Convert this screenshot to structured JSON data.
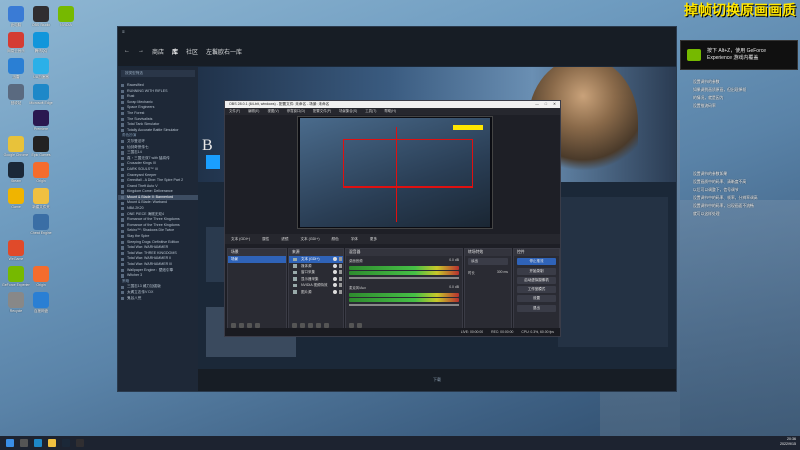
{
  "desktop": {
    "icons": [
      {
        "label": "此电脑",
        "color": "#3a7bd5"
      },
      {
        "label": "OBS Studio",
        "color": "#302e31"
      },
      {
        "label": "NVIDIA",
        "color": "#76b900"
      },
      {
        "label": "网易云音乐",
        "color": "#d43c33"
      },
      {
        "label": "腾讯QQ",
        "color": "#1296db"
      },
      {
        "label": "迅雷",
        "color": "#2a7fd4"
      },
      {
        "label": "UU加速器",
        "color": "#2bb0e8"
      },
      {
        "label": "回收站",
        "color": "#5a6a80"
      },
      {
        "label": "Microsoft Edge",
        "color": "#1e88c8"
      },
      {
        "label": "Premiere",
        "color": "#2a1850"
      },
      {
        "label": "Google Chrome",
        "color": "#e8c23a"
      },
      {
        "label": "Epic Games",
        "color": "#222"
      },
      {
        "label": "Steam",
        "color": "#1b2838"
      },
      {
        "label": "Origin",
        "color": "#f56c2d"
      },
      {
        "label": "Game",
        "color": "#f0b400"
      },
      {
        "label": "新建文件夹",
        "color": "#f0c040"
      },
      {
        "label": "Cheat Engine",
        "color": "#3a6ea5"
      },
      {
        "label": "WeGame",
        "color": "#e04a2a"
      },
      {
        "label": "GeForce Experience",
        "color": "#76b900"
      },
      {
        "label": "Origin",
        "color": "#f56c2d"
      },
      {
        "label": "Recycle",
        "color": "#888"
      },
      {
        "label": "百度网盘",
        "color": "#2a7fd4"
      }
    ]
  },
  "steam": {
    "nav": {
      "back": "←",
      "forward": "→",
      "store": "商店",
      "library": "库",
      "community": "社区",
      "user": "左鬟欧右一库"
    },
    "sidebar": {
      "filter": "按类型筛选",
      "items": [
        {
          "label": "Raceslfied",
          "kind": "item"
        },
        {
          "label": "RUNNING WITH RIFLES",
          "kind": "item"
        },
        {
          "label": "Rust",
          "kind": "item"
        },
        {
          "label": "Scrap Mechanic",
          "kind": "item"
        },
        {
          "label": "Space Engineers",
          "kind": "item"
        },
        {
          "label": "The Forest",
          "kind": "item"
        },
        {
          "label": "The Survivalists",
          "kind": "item"
        },
        {
          "label": "Total Tank Simulator",
          "kind": "item"
        },
        {
          "label": "Totally Accurate Battle Simulator",
          "kind": "item"
        },
        {
          "label": "角色扮演",
          "kind": "group"
        },
        {
          "label": "艾尔登法环",
          "kind": "item"
        },
        {
          "label": "仙剑奇侠传七",
          "kind": "item"
        },
        {
          "label": "三国志14",
          "kind": "item"
        },
        {
          "label": "真・三国无双7 with 猛将传",
          "kind": "item"
        },
        {
          "label": "Crusader Kings III",
          "kind": "item"
        },
        {
          "label": "DARK SOULS™ III",
          "kind": "item"
        },
        {
          "label": "Graveyard Keeper",
          "kind": "item"
        },
        {
          "label": "Greedfall - A Dive: The Spire Part 2",
          "kind": "item"
        },
        {
          "label": "Grand Theft Auto V",
          "kind": "item"
        },
        {
          "label": "Kingdom Come: Deliverance",
          "kind": "item"
        },
        {
          "label": "Mount & Blade II: Bannerlord",
          "kind": "selected"
        },
        {
          "label": "Mount & Blade: Warband",
          "kind": "item"
        },
        {
          "label": "NBA 2K20",
          "kind": "item"
        },
        {
          "label": "ONE PIECE 海贼无双4",
          "kind": "item"
        },
        {
          "label": "Romance of the Three Kingdoms",
          "kind": "item"
        },
        {
          "label": "Romance of the Three Kingdoms",
          "kind": "item"
        },
        {
          "label": "Sekiro™: Shadows Die Twice",
          "kind": "item"
        },
        {
          "label": "Slay the Spire",
          "kind": "item"
        },
        {
          "label": "Sleeping Dogs: Definitive Edition",
          "kind": "item"
        },
        {
          "label": "Total War: WARHAMMER",
          "kind": "item"
        },
        {
          "label": "Total War: THREE KINGDOMS",
          "kind": "item"
        },
        {
          "label": "Total War: WARHAMMER II",
          "kind": "item"
        },
        {
          "label": "Total War: WARHAMMER III",
          "kind": "item"
        },
        {
          "label": "Wallpaper Engine：壁纸引擎",
          "kind": "item"
        },
        {
          "label": "Witcher 3",
          "kind": "item"
        },
        {
          "label": "策略",
          "kind": "group"
        },
        {
          "label": "三国志13 威力加强版",
          "kind": "item"
        },
        {
          "label": "太阁立志传V DX",
          "kind": "item"
        },
        {
          "label": "鬼谷八荒",
          "kind": "item"
        }
      ]
    },
    "hero_title": "B",
    "bottom": "下载"
  },
  "obs": {
    "title": "OBS 28.0.1 (64-bit, windows) - 配置文件: 未命名 - 场景: 未命名",
    "menu": [
      "文件(F)",
      "编辑(E)",
      "视图(V)",
      "停靠窗口(D)",
      "配置文件(P)",
      "场景集合(S)",
      "工具(T)",
      "帮助(H)"
    ],
    "source_bar": [
      "文本 (GDI+)",
      "属性",
      "滤镜",
      "文本 (GDI+)",
      "颜色",
      "字体",
      "更多"
    ],
    "scenes": {
      "title": "场景",
      "items": [
        "场景"
      ]
    },
    "sources": {
      "title": "来源",
      "items": [
        "文本 (GDI+)",
        "媒体源",
        "窗口采集",
        "显示器采集",
        "NVIDIA 视频特效",
        "图片源"
      ]
    },
    "mixer": {
      "title": "混音器",
      "tracks": [
        {
          "name": "桌面音频",
          "db": "0.0 dB"
        },
        {
          "name": "麦克风/Aux",
          "db": "0.0 dB"
        }
      ]
    },
    "transitions": {
      "title": "转场特效",
      "type": "淡出",
      "duration_label": "时长",
      "duration": "300 ms"
    },
    "controls": {
      "title": "控件",
      "buttons": [
        "停止推流",
        "开始录制",
        "启动虚拟摄像机",
        "工作室模式",
        "设置",
        "退出"
      ]
    },
    "status": {
      "live": "LIVE: 00:00:00",
      "rec": "REC: 00:00:00",
      "cpu": "CPU: 0.3%, 60.00 fps"
    }
  },
  "overlay": {
    "title": "掉帧切换原画画质",
    "toast_line1": "按下 Alt+Z，使用 GeForce",
    "toast_line2": "Experience 游戏内覆盖",
    "notes": [
      "设置调节的参数",
      "如果调到画质原画，但出现掉帧",
      "的情况，就是因为",
      "设置推流码率",
      "设置调节的参数如果",
      "设置画质中的码率、清晰度不高",
      "以后可以调整下，信号调节",
      "设置调节中的码率、帧率，分辨率调高",
      "设置调节中的码率，出现画面不流畅",
      "就可以这样处理"
    ]
  },
  "taskbar": {
    "time": "20:36",
    "date": "2022/9/15"
  }
}
